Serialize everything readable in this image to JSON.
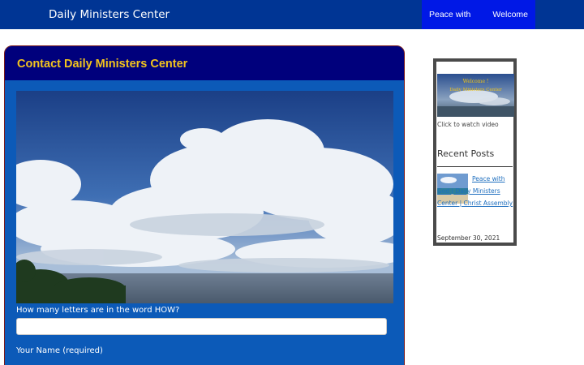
{
  "header": {
    "site_title": "Daily Ministers Center",
    "nav": [
      {
        "label": "Peace with God"
      },
      {
        "label": "Welcome"
      }
    ]
  },
  "main": {
    "title": "Contact Daily Ministers Center",
    "captcha_label": "How many letters are in the word HOW?",
    "captcha_value": "",
    "name_label": "Your Name (required)"
  },
  "sidebar": {
    "video": {
      "thumb_text_line1": "Welcome !",
      "thumb_text_line2": "Daily Ministers Center",
      "caption": "Click to watch video"
    },
    "recent_posts": {
      "title": "Recent Posts",
      "items": [
        {
          "title": "Peace with God | Daily Ministers Center | Christ Assembly",
          "date": "September 30, 2021"
        }
      ]
    }
  },
  "colors": {
    "topbar": "#003594",
    "nav_active": "#0018e6",
    "panel": "#0c5ab8",
    "panel_header": "#00007c",
    "title_gold": "#f3c41d",
    "link": "#1f6fbf"
  },
  "icons": []
}
